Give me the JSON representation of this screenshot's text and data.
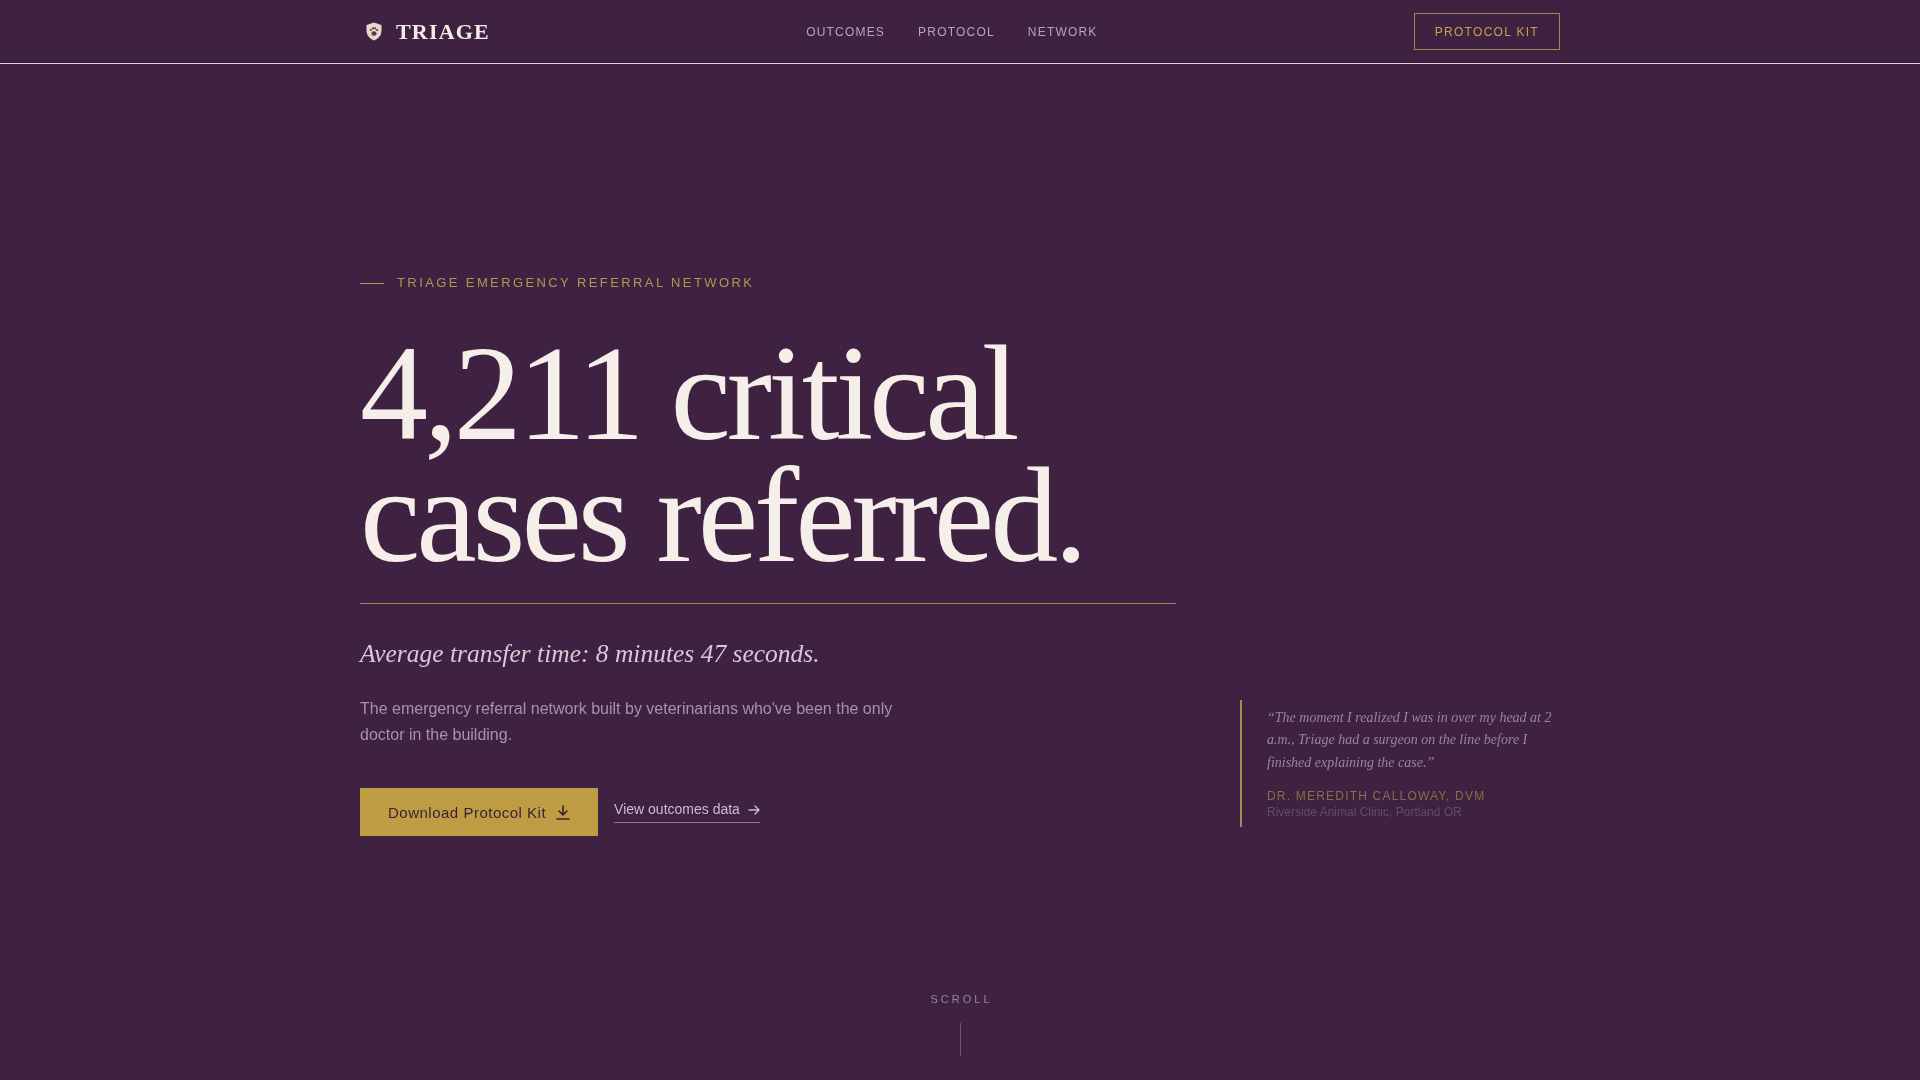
{
  "nav": {
    "brand": "TRIAGE",
    "links": [
      "OUTCOMES",
      "PROTOCOL",
      "NETWORK"
    ],
    "cta": "PROTOCOL KIT"
  },
  "hero": {
    "eyebrow": "TRIAGE EMERGENCY REFERRAL NETWORK",
    "heading": "4,211 critical cases referred.",
    "subtitle": "Average transfer time: 8 minutes 47 seconds.",
    "description": "The emergency referral network built by veterinarians who've been the only doctor in the building.",
    "primary_button": "Download Protocol Kit",
    "secondary_link": "View outcomes data"
  },
  "testimonial": {
    "quote": "“The moment I realized I was in over my head at 2 a.m., Triage had a surgeon on the line before I finished explaining the case.”",
    "author": "DR. MEREDITH CALLOWAY, DVM",
    "affiliation": "Riverside Animal Clinic, Portland OR"
  },
  "scroll_hint": "SCROLL"
}
